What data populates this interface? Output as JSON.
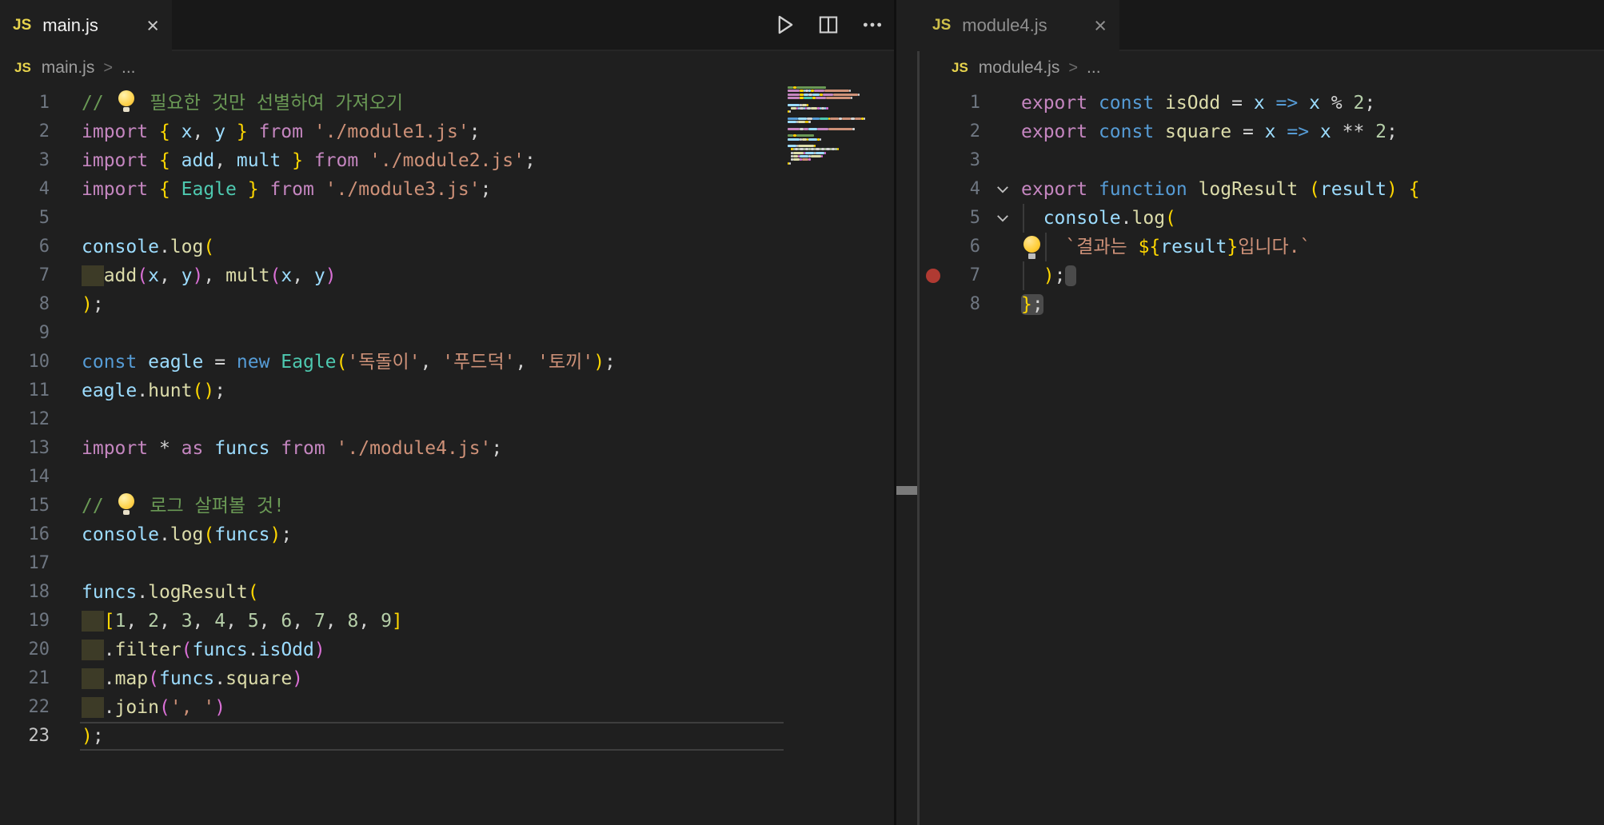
{
  "colors": {
    "editor_bg": "#1f1f1f",
    "tabbar_bg": "#181818",
    "js_icon": "#e8d44d",
    "comment": "#6A9955",
    "keyword": "#C586C0",
    "keyword_blue": "#569CD6",
    "variable": "#9CDCFE",
    "function": "#DCDCAA",
    "class": "#4EC9B0",
    "string": "#CE9178",
    "number": "#B5CEA8",
    "punct": "#d4d4d4",
    "bracket1": "#FFD700",
    "bracket2": "#DA70D6",
    "emoji": "#FFCC00",
    "breakpoint": "#b03a32",
    "indent_highlight": "#3d3b27"
  },
  "toolbar": {
    "icons": [
      "run-icon",
      "split-editor-icon",
      "more-actions-icon"
    ]
  },
  "left_editor": {
    "tab": {
      "icon": "JS",
      "label": "main.js",
      "close": "×"
    },
    "breadcrumb": {
      "icon": "JS",
      "file": "main.js",
      "separator": ">",
      "tail": "..."
    },
    "lines": [
      {
        "n": 1,
        "t": [
          [
            "// ",
            "cm"
          ],
          [
            "💡",
            "emoji"
          ],
          [
            " 필요한 것만 선별하여 가져오기",
            "cm"
          ]
        ]
      },
      {
        "n": 2,
        "t": [
          [
            "import ",
            "kw"
          ],
          [
            "{ ",
            "b1"
          ],
          [
            "x",
            "vr"
          ],
          [
            ", ",
            "pt"
          ],
          [
            "y",
            "vr"
          ],
          [
            " }",
            "b1"
          ],
          [
            " from ",
            "kw"
          ],
          [
            "'./module1.js'",
            "st"
          ],
          [
            ";",
            "pt"
          ]
        ]
      },
      {
        "n": 3,
        "t": [
          [
            "import ",
            "kw"
          ],
          [
            "{ ",
            "b1"
          ],
          [
            "add",
            "vr"
          ],
          [
            ", ",
            "pt"
          ],
          [
            "mult",
            "vr"
          ],
          [
            " }",
            "b1"
          ],
          [
            " from ",
            "kw"
          ],
          [
            "'./module2.js'",
            "st"
          ],
          [
            ";",
            "pt"
          ]
        ]
      },
      {
        "n": 4,
        "t": [
          [
            "import ",
            "kw"
          ],
          [
            "{ ",
            "b1"
          ],
          [
            "Eagle",
            "cl"
          ],
          [
            " }",
            "b1"
          ],
          [
            " from ",
            "kw"
          ],
          [
            "'./module3.js'",
            "st"
          ],
          [
            ";",
            "pt"
          ]
        ]
      },
      {
        "n": 5,
        "t": []
      },
      {
        "n": 6,
        "t": [
          [
            "console",
            "vr"
          ],
          [
            ".",
            "pt"
          ],
          [
            "log",
            "fn"
          ],
          [
            "(",
            "b1"
          ]
        ]
      },
      {
        "n": 7,
        "t": [
          [
            "  ",
            "ol"
          ],
          [
            "add",
            "fn"
          ],
          [
            "(",
            "b2"
          ],
          [
            "x",
            "vr"
          ],
          [
            ", ",
            "pt"
          ],
          [
            "y",
            "vr"
          ],
          [
            ")",
            "b2"
          ],
          [
            ", ",
            "pt"
          ],
          [
            "mult",
            "fn"
          ],
          [
            "(",
            "b2"
          ],
          [
            "x",
            "vr"
          ],
          [
            ", ",
            "pt"
          ],
          [
            "y",
            "vr"
          ],
          [
            ")",
            "b2"
          ]
        ]
      },
      {
        "n": 8,
        "t": [
          [
            ")",
            "b1"
          ],
          [
            ";",
            "pt"
          ]
        ]
      },
      {
        "n": 9,
        "t": []
      },
      {
        "n": 10,
        "t": [
          [
            "const ",
            "kb"
          ],
          [
            "eagle",
            "vr"
          ],
          [
            " = ",
            "pt"
          ],
          [
            "new ",
            "kb"
          ],
          [
            "Eagle",
            "cl"
          ],
          [
            "(",
            "b1"
          ],
          [
            "'독돌이'",
            "st"
          ],
          [
            ", ",
            "pt"
          ],
          [
            "'푸드덕'",
            "st"
          ],
          [
            ", ",
            "pt"
          ],
          [
            "'토끼'",
            "st"
          ],
          [
            ")",
            "b1"
          ],
          [
            ";",
            "pt"
          ]
        ]
      },
      {
        "n": 11,
        "t": [
          [
            "eagle",
            "vr"
          ],
          [
            ".",
            "pt"
          ],
          [
            "hunt",
            "fn"
          ],
          [
            "(",
            "b1"
          ],
          [
            ")",
            "b1"
          ],
          [
            ";",
            "pt"
          ]
        ]
      },
      {
        "n": 12,
        "t": []
      },
      {
        "n": 13,
        "t": [
          [
            "import ",
            "kw"
          ],
          [
            "* ",
            "pt"
          ],
          [
            "as ",
            "kw"
          ],
          [
            "funcs",
            "vr"
          ],
          [
            " from ",
            "kw"
          ],
          [
            "'./module4.js'",
            "st"
          ],
          [
            ";",
            "pt"
          ]
        ]
      },
      {
        "n": 14,
        "t": []
      },
      {
        "n": 15,
        "t": [
          [
            "// ",
            "cm"
          ],
          [
            "💡",
            "emoji"
          ],
          [
            " 로그 살펴볼 것!",
            "cm"
          ]
        ]
      },
      {
        "n": 16,
        "t": [
          [
            "console",
            "vr"
          ],
          [
            ".",
            "pt"
          ],
          [
            "log",
            "fn"
          ],
          [
            "(",
            "b1"
          ],
          [
            "funcs",
            "vr"
          ],
          [
            ")",
            "b1"
          ],
          [
            ";",
            "pt"
          ]
        ]
      },
      {
        "n": 17,
        "t": []
      },
      {
        "n": 18,
        "t": [
          [
            "funcs",
            "vr"
          ],
          [
            ".",
            "pt"
          ],
          [
            "logResult",
            "fn"
          ],
          [
            "(",
            "b1"
          ]
        ]
      },
      {
        "n": 19,
        "t": [
          [
            "  ",
            "ol"
          ],
          [
            "[",
            "b1"
          ],
          [
            "1",
            "nu"
          ],
          [
            ", ",
            "pt"
          ],
          [
            "2",
            "nu"
          ],
          [
            ", ",
            "pt"
          ],
          [
            "3",
            "nu"
          ],
          [
            ", ",
            "pt"
          ],
          [
            "4",
            "nu"
          ],
          [
            ", ",
            "pt"
          ],
          [
            "5",
            "nu"
          ],
          [
            ", ",
            "pt"
          ],
          [
            "6",
            "nu"
          ],
          [
            ", ",
            "pt"
          ],
          [
            "7",
            "nu"
          ],
          [
            ", ",
            "pt"
          ],
          [
            "8",
            "nu"
          ],
          [
            ", ",
            "pt"
          ],
          [
            "9",
            "nu"
          ],
          [
            "]",
            "b1"
          ]
        ]
      },
      {
        "n": 20,
        "t": [
          [
            "  ",
            "ol"
          ],
          [
            ".",
            "pt"
          ],
          [
            "filter",
            "fn"
          ],
          [
            "(",
            "b2"
          ],
          [
            "funcs",
            "vr"
          ],
          [
            ".",
            "pt"
          ],
          [
            "isOdd",
            "vr"
          ],
          [
            ")",
            "b2"
          ]
        ]
      },
      {
        "n": 21,
        "t": [
          [
            "  ",
            "ol"
          ],
          [
            ".",
            "pt"
          ],
          [
            "map",
            "fn"
          ],
          [
            "(",
            "b2"
          ],
          [
            "funcs",
            "vr"
          ],
          [
            ".",
            "pt"
          ],
          [
            "square",
            "fn"
          ],
          [
            ")",
            "b2"
          ]
        ]
      },
      {
        "n": 22,
        "t": [
          [
            "  ",
            "ol"
          ],
          [
            ".",
            "pt"
          ],
          [
            "join",
            "fn"
          ],
          [
            "(",
            "b2"
          ],
          [
            "', '",
            "st"
          ],
          [
            ")",
            "b2"
          ]
        ]
      },
      {
        "n": 23,
        "cur": true,
        "t": [
          [
            ")",
            "b1"
          ],
          [
            ";",
            "pt"
          ]
        ]
      }
    ]
  },
  "right_editor": {
    "tab": {
      "icon": "JS",
      "label": "module4.js",
      "close": "×"
    },
    "breadcrumb": {
      "icon": "JS",
      "file": "module4.js",
      "separator": ">",
      "tail": "..."
    },
    "lines": [
      {
        "n": 1,
        "t": [
          [
            "export ",
            "kw"
          ],
          [
            "const ",
            "kb"
          ],
          [
            "isOdd",
            "fn"
          ],
          [
            " = ",
            "pt"
          ],
          [
            "x",
            "vr"
          ],
          [
            " => ",
            "kb"
          ],
          [
            "x",
            "vr"
          ],
          [
            " % ",
            "pt"
          ],
          [
            "2",
            "nu"
          ],
          [
            ";",
            "pt"
          ]
        ]
      },
      {
        "n": 2,
        "t": [
          [
            "export ",
            "kw"
          ],
          [
            "const ",
            "kb"
          ],
          [
            "square",
            "fn"
          ],
          [
            " = ",
            "pt"
          ],
          [
            "x",
            "vr"
          ],
          [
            " => ",
            "kb"
          ],
          [
            "x",
            "vr"
          ],
          [
            " ** ",
            "pt"
          ],
          [
            "2",
            "nu"
          ],
          [
            ";",
            "pt"
          ]
        ]
      },
      {
        "n": 3,
        "t": []
      },
      {
        "n": 4,
        "chev": true,
        "t": [
          [
            "export ",
            "kw"
          ],
          [
            "function ",
            "kb"
          ],
          [
            "logResult",
            "fn"
          ],
          [
            " (",
            "b1"
          ],
          [
            "result",
            "vr"
          ],
          [
            ")",
            "b1"
          ],
          [
            " {",
            "b1"
          ]
        ]
      },
      {
        "n": 5,
        "chev": true,
        "guides": [
          0
        ],
        "t": [
          [
            "  ",
            "ws"
          ],
          [
            "console",
            "vr"
          ],
          [
            ".",
            "pt"
          ],
          [
            "log",
            "fn"
          ],
          [
            "(",
            "b1"
          ]
        ]
      },
      {
        "n": 6,
        "bulb": true,
        "guides": [
          2
        ],
        "t": [
          [
            "    ",
            "ws"
          ],
          [
            "`결과는 ",
            "st"
          ],
          [
            "${",
            "b1"
          ],
          [
            "result",
            "vr"
          ],
          [
            "}",
            "b1"
          ],
          [
            "입니다.`",
            "st"
          ]
        ]
      },
      {
        "n": 7,
        "bp": true,
        "guides": [
          0
        ],
        "t": [
          [
            "  ",
            "ws"
          ],
          [
            ")",
            "b1"
          ],
          [
            ";",
            "pt"
          ],
          [
            " ",
            "pt",
            1
          ]
        ]
      },
      {
        "n": 8,
        "t": [
          [
            "}",
            "b1",
            1
          ],
          [
            ";",
            "pt",
            1
          ]
        ]
      }
    ]
  }
}
